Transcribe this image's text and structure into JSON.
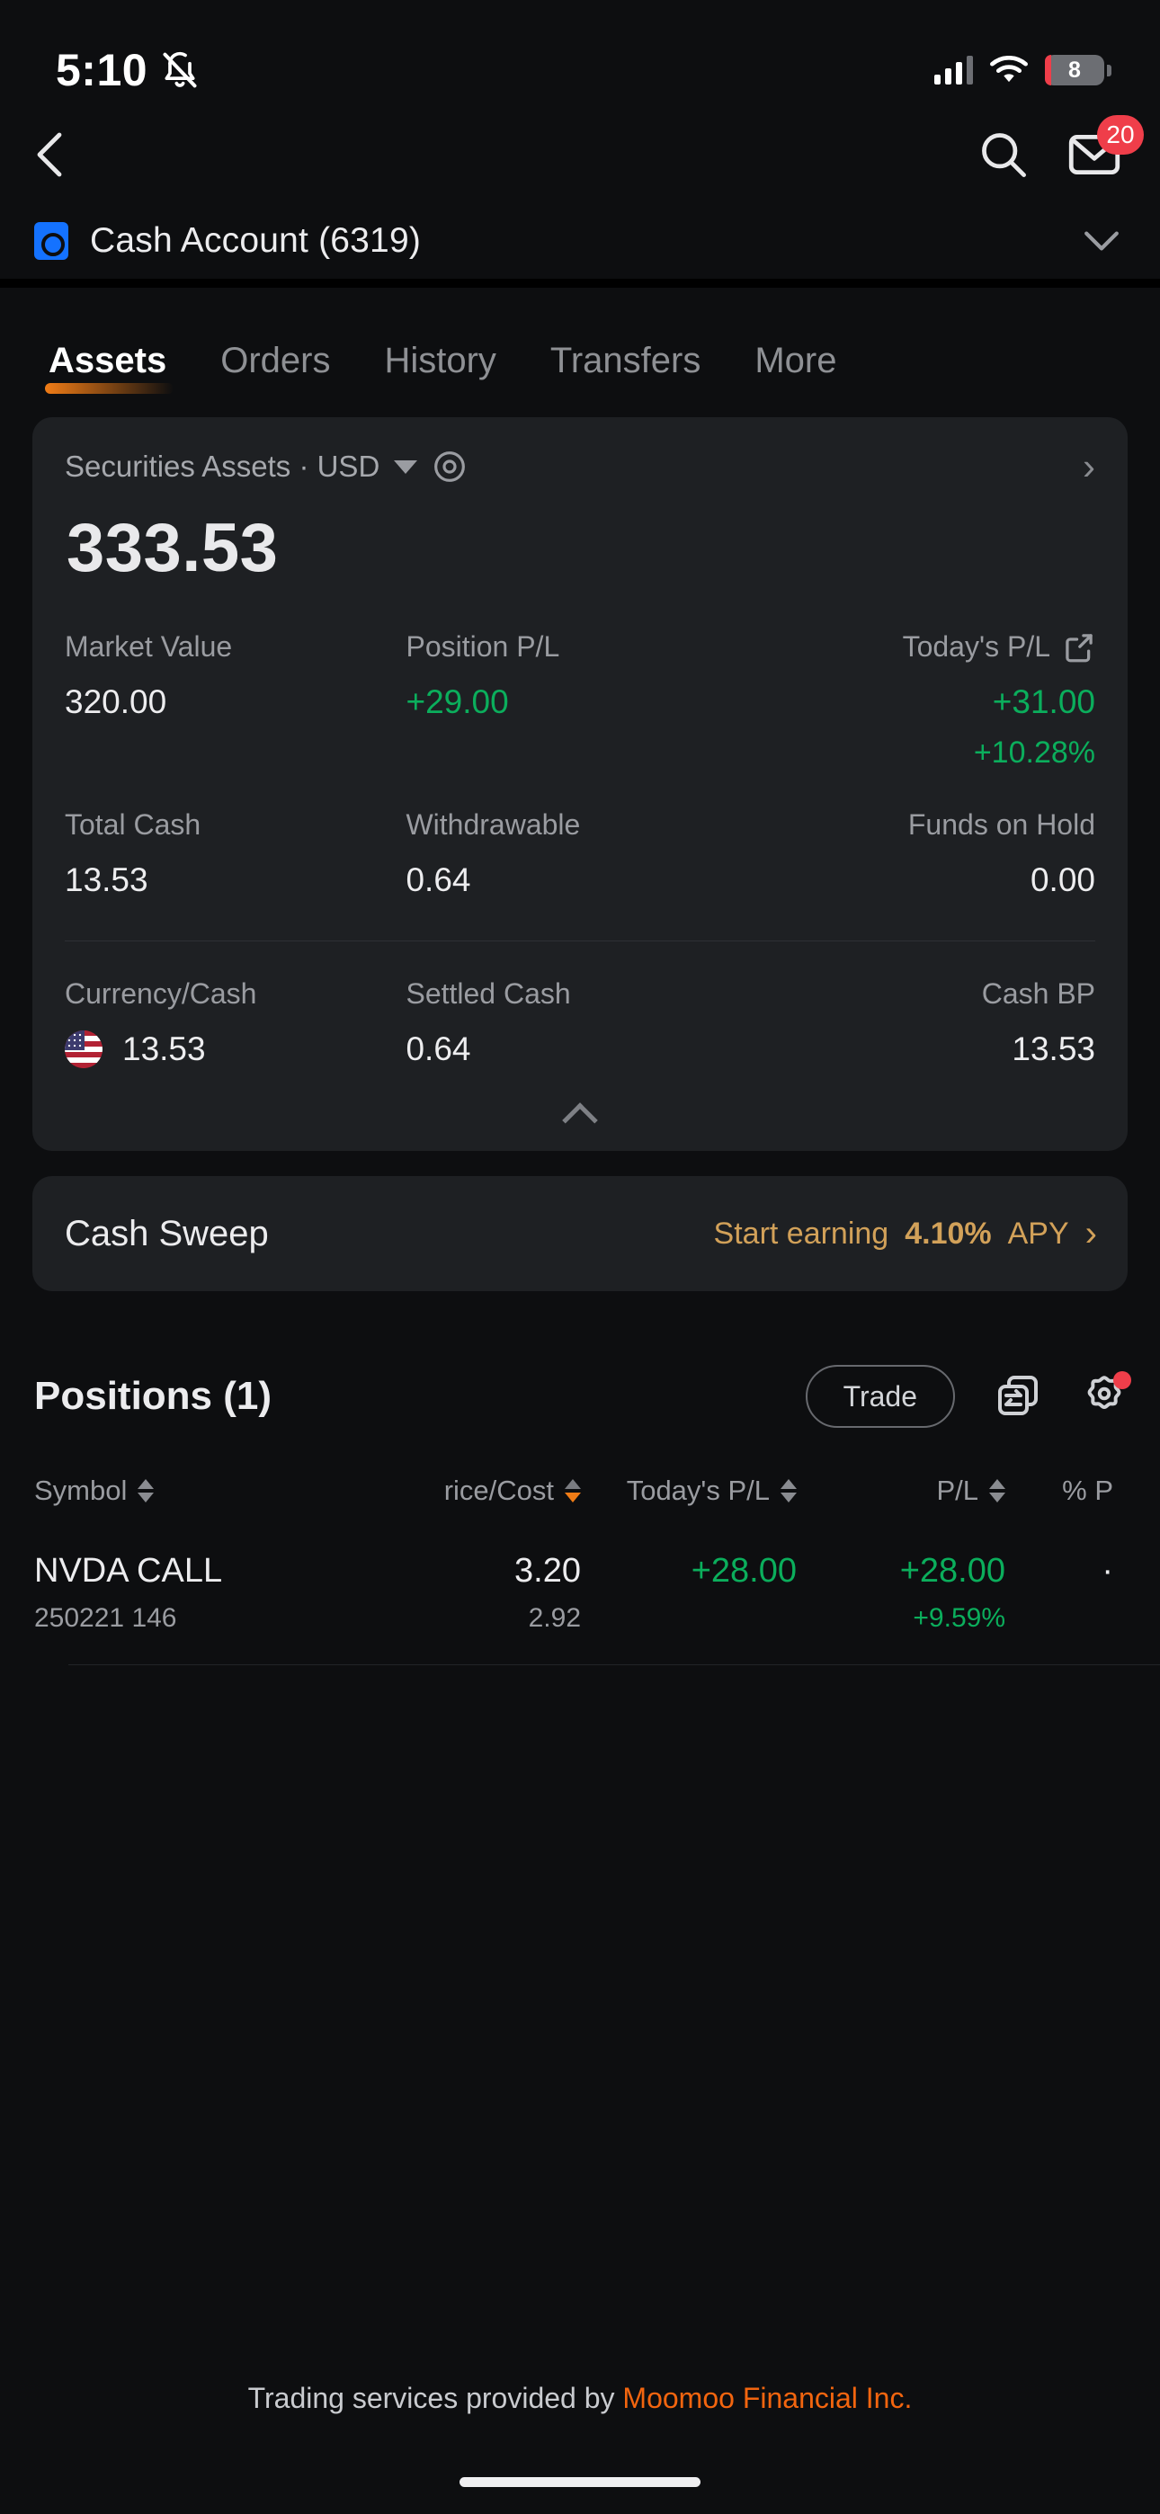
{
  "status_bar": {
    "time": "5:10",
    "silent_icon": "bell-slash-icon",
    "battery_level": "8",
    "battery_low": true,
    "signal_icon": "cellular-bars-icon",
    "wifi_icon": "wifi-icon"
  },
  "nav": {
    "back_icon": "chevron-left-icon",
    "search_icon": "search-icon",
    "mail_icon": "mail-icon",
    "mail_badge": "20"
  },
  "account": {
    "icon": "wallet-icon",
    "name": "Cash Account (6319)",
    "expand_icon": "chevron-down-icon"
  },
  "tabs": [
    {
      "label": "Assets",
      "active": true
    },
    {
      "label": "Orders",
      "active": false
    },
    {
      "label": "History",
      "active": false
    },
    {
      "label": "Transfers",
      "active": false
    },
    {
      "label": "More",
      "active": false
    }
  ],
  "assets_card": {
    "section_label": "Securities Assets · USD",
    "currency_caret": "chevron-down-icon",
    "visibility_icon": "eye-icon",
    "detail_chevron": "chevron-right-icon",
    "balance": "333.53",
    "share_icon": "share-icon",
    "collapse_icon": "chevron-up-icon",
    "metrics_row1": [
      {
        "label": "Market Value",
        "value": "320.00",
        "positive": false
      },
      {
        "label": "Position P/L",
        "value": "+29.00",
        "positive": true
      },
      {
        "label": "Today's P/L",
        "value": "+31.00",
        "sub": "+10.28%",
        "positive": true
      }
    ],
    "metrics_row2": [
      {
        "label": "Total Cash",
        "value": "13.53"
      },
      {
        "label": "Withdrawable",
        "value": "0.64"
      },
      {
        "label": "Funds on Hold",
        "value": "0.00"
      }
    ],
    "metrics_row3": [
      {
        "label": "Currency/Cash",
        "value": "13.53",
        "flag": "us-flag-icon"
      },
      {
        "label": "Settled Cash",
        "value": "0.64"
      },
      {
        "label": "Cash BP",
        "value": "13.53"
      }
    ]
  },
  "cash_sweep": {
    "title": "Cash Sweep",
    "cta_prefix": "Start earning ",
    "cta_rate": "4.10%",
    "cta_suffix": " APY",
    "chevron": "chevron-right-icon",
    "accent_color": "#d2a159"
  },
  "positions": {
    "title": "Positions (1)",
    "trade_label": "Trade",
    "transfer_icon": "transfer-icon",
    "settings_icon": "gear-icon",
    "settings_has_badge": true,
    "columns": [
      {
        "label": "Symbol",
        "sort": "none"
      },
      {
        "label": "rice/Cost",
        "sort": "desc"
      },
      {
        "label": "Today's P/L",
        "sort": "none"
      },
      {
        "label": "P/L",
        "sort": "none"
      },
      {
        "label": "% P",
        "sort": "none"
      }
    ],
    "rows": [
      {
        "symbol": "NVDA CALL",
        "contract": "250221 146",
        "price": "3.20",
        "cost": "2.92",
        "today_pl": "+28.00",
        "pl": "+28.00",
        "pl_pct": "+9.59%"
      }
    ]
  },
  "footer": {
    "text": "Trading services provided by ",
    "link": "Moomoo Financial Inc."
  },
  "colors": {
    "background": "#0d0e10",
    "card": "#1e2023",
    "positive_green": "#0bae5c",
    "accent_orange": "#f07c16",
    "brand_orange": "#f2650f",
    "gold": "#d2a159",
    "badge_red": "#ef3e4a",
    "blue": "#1472ff"
  }
}
